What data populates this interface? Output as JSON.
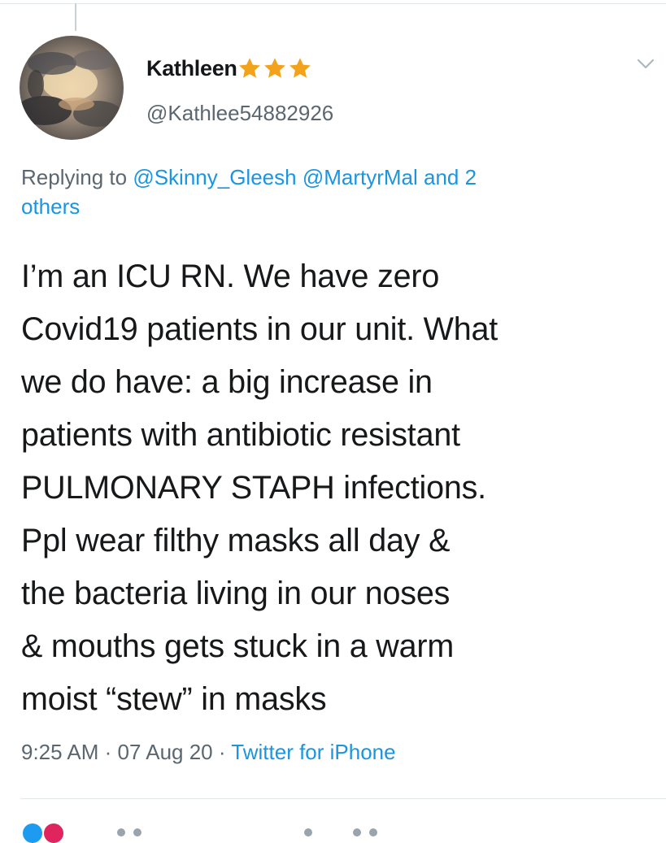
{
  "tweet": {
    "display_name": "Kathleen",
    "badge_icons": [
      "star-icon",
      "star-icon",
      "star-icon"
    ],
    "handle": "@Kathlee54882926",
    "reply_prefix": "Replying to ",
    "reply_mentions": [
      "@Skinny_Gleesh",
      "@MartyrMal",
      "and 2",
      "others"
    ],
    "body_lines": [
      "I’m an ICU RN. We have zero",
      "Covid19 patients in our unit. What",
      "we do have: a big increase in",
      "patients with antibiotic resistant",
      "PULMONARY STAPH infections.",
      "Ppl wear filthy masks all day &",
      "the bacteria living in our noses",
      "& mouths gets stuck in a warm",
      "moist “stew” in masks"
    ],
    "time": "9:25 AM",
    "date": "07 Aug 20",
    "separator": " · ",
    "source": "Twitter for iPhone"
  },
  "colors": {
    "link": "#1b95e0",
    "secondary_text": "#5b6770",
    "star": "#f2a31b"
  }
}
